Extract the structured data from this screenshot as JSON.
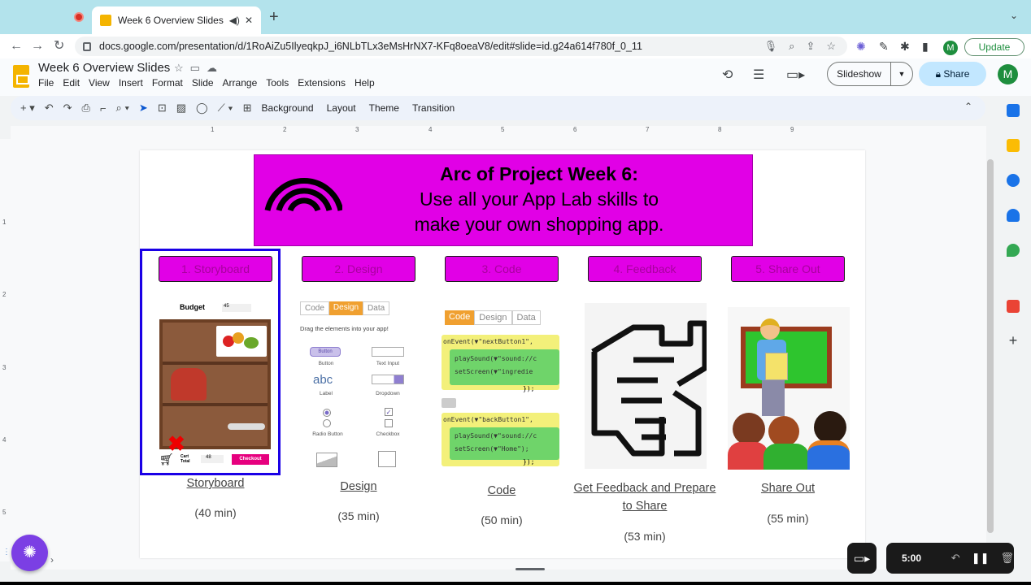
{
  "browser": {
    "tab_title": "Week 6 Overview Slides - G",
    "url": "docs.google.com/presentation/d/1RoAiZu5IlyeqkpJ_i6NLbTLx3eMsHrNX7-KFq8oeaV8/edit#slide=id.g24a614f780f_0_11",
    "update_label": "Update",
    "profile_initial": "M"
  },
  "app": {
    "doc_title": "Week 6 Overview Slides",
    "menus": [
      "File",
      "Edit",
      "View",
      "Insert",
      "Format",
      "Slide",
      "Arrange",
      "Tools",
      "Extensions",
      "Help"
    ],
    "slideshow_label": "Slideshow",
    "share_label": "Share",
    "avatar_initial": "M"
  },
  "toolbar": {
    "background_label": "Background",
    "layout_label": "Layout",
    "theme_label": "Theme",
    "transition_label": "Transition"
  },
  "ruler": {
    "h": [
      "1",
      "2",
      "3",
      "4",
      "5",
      "6",
      "7",
      "8",
      "9"
    ],
    "v": [
      "1",
      "2",
      "3",
      "4",
      "5"
    ]
  },
  "slide": {
    "banner": {
      "line1": "Arc of Project Week 6:",
      "line2": "Use all your App Lab skills to",
      "line3": "make your own shopping app."
    },
    "steps": [
      {
        "button": "1. Storyboard",
        "caption": "Storyboard",
        "time": "(40 min)"
      },
      {
        "button": "2. Design",
        "caption": "Design",
        "time": "(35 min)"
      },
      {
        "button": "3. Code",
        "caption": "Code",
        "time": "(50 min)"
      },
      {
        "button": "4. Feedback",
        "caption": "Get Feedback and Prepare to Share",
        "time": "(53 min)"
      },
      {
        "button": "5. Share Out",
        "caption": "Share Out",
        "time": "(55 min)"
      }
    ],
    "storyboard_img": {
      "budget": "Budget",
      "budget_val": "45",
      "cart": "Cart Total",
      "cart_val": "48",
      "checkout": "Checkout"
    },
    "design_img": {
      "tabs": [
        "Code",
        "Design",
        "Data"
      ],
      "hint": "Drag the elements into your app!",
      "items": [
        "Button",
        "Text Input",
        "Label",
        "Dropdown",
        "Radio Button",
        "Checkbox"
      ],
      "button_text": "Button",
      "abc": "abc"
    },
    "code_img": {
      "tabs": [
        "Code",
        "Design",
        "Data"
      ],
      "lines": [
        "onEvent(▼\"nextButton1\",",
        "playSound(▼\"sound://c",
        "setScreen(▼\"ingredie",
        "});",
        "onEvent(▼\"backButton1\",",
        "playSound(▼\"sound://c",
        "setScreen(▼\"Home\");",
        "});"
      ]
    }
  },
  "recorder": {
    "time": "5:00"
  },
  "colors": {
    "banner": "#e100e6",
    "selection": "#1a00e6",
    "accent": "#0b57d0"
  }
}
